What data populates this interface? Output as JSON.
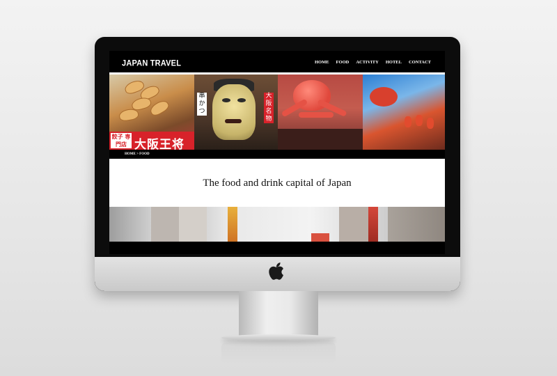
{
  "site": {
    "logo": "JAPAN TRAVEL",
    "nav": [
      "HOME",
      "FOOD",
      "ACTIVITY",
      "HOTEL",
      "CONTACT"
    ]
  },
  "hero": {
    "signs": {
      "gyoza_big": "大阪王将",
      "gyoza_small": "餃子 専門店",
      "kushikatsu": "串かつ",
      "osaka_meibutsu": "大阪名物"
    }
  },
  "breadcrumb": "HOME > FOOD",
  "headline": "The food and drink capital of Japan",
  "colors": {
    "screen_bg": "#000000",
    "content_bg": "#ffffff",
    "sign_red": "#d8222a"
  },
  "icons": {
    "brand": "apple-logo-icon"
  }
}
